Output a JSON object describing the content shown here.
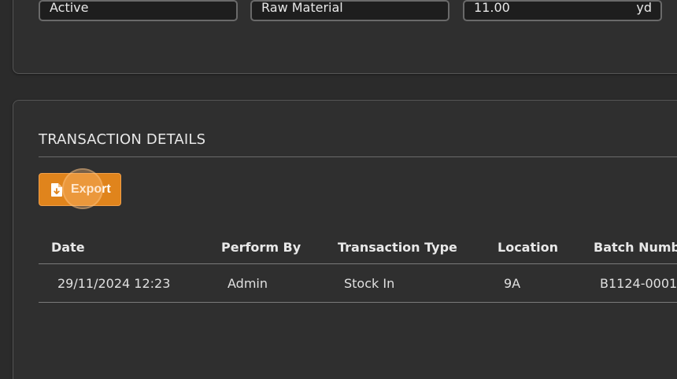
{
  "top_fields": {
    "status_value": "Active",
    "category_value": "Raw Material",
    "quantity_value": "11.00",
    "quantity_unit": "yd"
  },
  "transactions": {
    "title": "TRANSACTION DETAILS",
    "export_label": "Export",
    "columns": [
      "Date",
      "Perform By",
      "Transaction Type",
      "Location",
      "Batch Number"
    ],
    "rows": [
      [
        "29/11/2024 12:23",
        "Admin",
        "Stock In",
        "9A",
        "B1124-0001"
      ]
    ]
  },
  "colors": {
    "background": "#2b2b2b",
    "card": "#2f2f2f",
    "accent": "#e0841c"
  },
  "icons": {
    "export": "file-download-icon"
  }
}
